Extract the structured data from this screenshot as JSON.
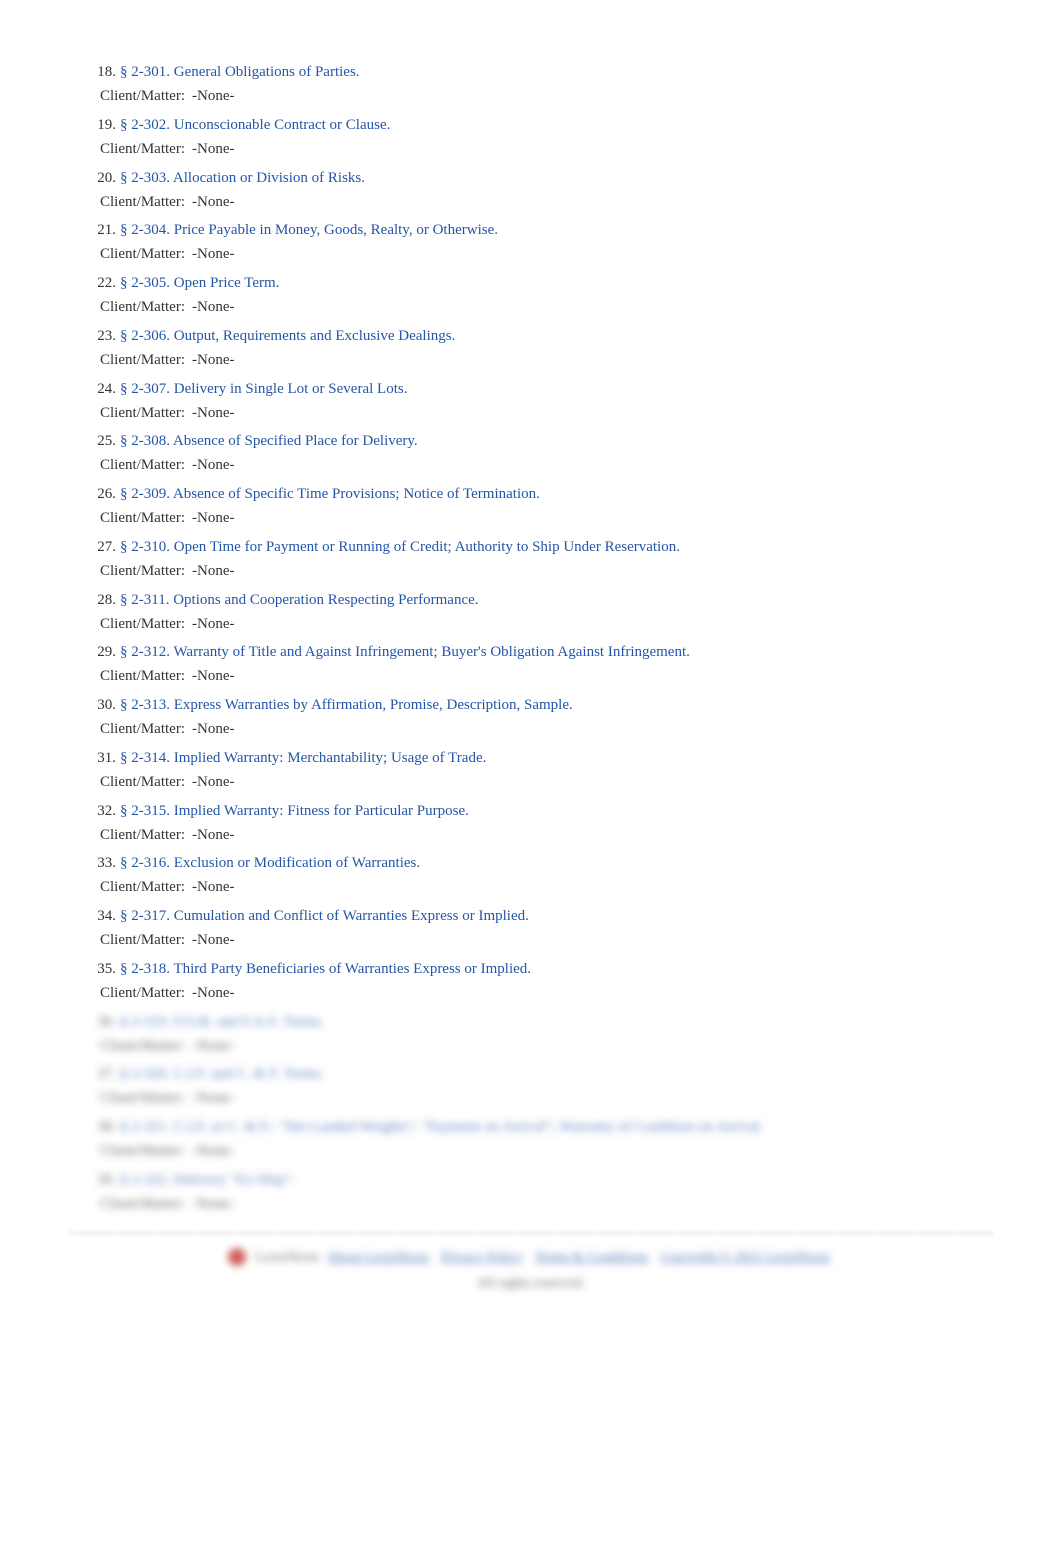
{
  "meta_label": "Client/Matter:",
  "meta_value": "-None-",
  "items": [
    {
      "num": "18.",
      "title": "§ 2-301. General Obligations of Parties.",
      "blurred": false
    },
    {
      "num": "19.",
      "title": "§ 2-302. Unconscionable Contract or Clause.",
      "blurred": false
    },
    {
      "num": "20.",
      "title": "§ 2-303. Allocation or Division of Risks.",
      "blurred": false
    },
    {
      "num": "21.",
      "title": "§ 2-304. Price Payable in Money, Goods, Realty, or Otherwise.",
      "blurred": false
    },
    {
      "num": "22.",
      "title": "§ 2-305. Open Price Term.",
      "blurred": false
    },
    {
      "num": "23.",
      "title": "§ 2-306. Output, Requirements and Exclusive Dealings.",
      "blurred": false
    },
    {
      "num": "24.",
      "title": "§ 2-307. Delivery in Single Lot or Several Lots.",
      "blurred": false
    },
    {
      "num": "25.",
      "title": "§ 2-308. Absence of Specified Place for Delivery.",
      "blurred": false
    },
    {
      "num": "26.",
      "title": "§ 2-309. Absence of Specific Time Provisions; Notice of Termination.",
      "blurred": false
    },
    {
      "num": "27.",
      "title": "§ 2-310. Open Time for Payment or Running of Credit; Authority to Ship Under Reservation.",
      "blurred": false
    },
    {
      "num": "28.",
      "title": "§ 2-311. Options and Cooperation Respecting Performance.",
      "blurred": false
    },
    {
      "num": "29.",
      "title": "§ 2-312. Warranty of Title and Against Infringement; Buyer's Obligation Against Infringement.",
      "blurred": false
    },
    {
      "num": "30.",
      "title": "§ 2-313. Express Warranties by Affirmation, Promise, Description, Sample.",
      "blurred": false
    },
    {
      "num": "31.",
      "title": "§ 2-314. Implied Warranty: Merchantability; Usage of Trade.",
      "blurred": false
    },
    {
      "num": "32.",
      "title": "§ 2-315. Implied Warranty: Fitness for Particular Purpose.",
      "blurred": false
    },
    {
      "num": "33.",
      "title": "§ 2-316. Exclusion or Modification of Warranties.",
      "blurred": false
    },
    {
      "num": "34.",
      "title": "§ 2-317. Cumulation and Conflict of Warranties Express or Implied.",
      "blurred": false
    },
    {
      "num": "35.",
      "title": "§ 2-318. Third Party Beneficiaries of Warranties Express or Implied.",
      "blurred": false
    },
    {
      "num": "36.",
      "title": "§ 2-319. F.O.B. and F.A.S. Terms.",
      "blurred": true
    },
    {
      "num": "37.",
      "title": "§ 2-320. C.I.F. and C. & F. Terms.",
      "blurred": true
    },
    {
      "num": "38.",
      "title": "§ 2-321. C.I.F. or C. & F.: \"Net Landed Weights\"; \"Payment on Arrival\"; Warranty of Condition on Arrival.",
      "blurred": true
    },
    {
      "num": "39.",
      "title": "§ 2-322. Delivery \"Ex-Ship\".",
      "blurred": true
    }
  ],
  "footer": {
    "brand": "LexisNexis",
    "links": [
      "About LexisNexis",
      "Privacy Policy",
      "Terms & Conditions",
      "Copyright © 2021 LexisNexis"
    ],
    "tagline": "All rights reserved."
  }
}
